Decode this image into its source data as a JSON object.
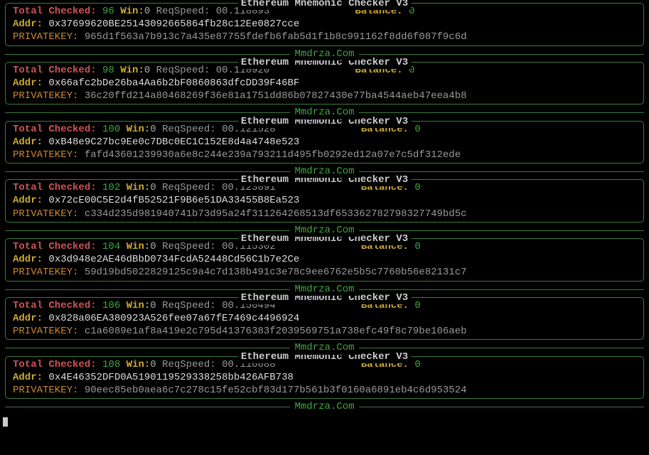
{
  "title": "Ethereum Mnemonic Checker V3",
  "footer": "Mmdrza.Com",
  "labels": {
    "totalChecked": "Total Checked:",
    "win": "Win:",
    "reqSpeed": "ReqSpeed:",
    "balance": "Balance:",
    "addr": "Addr:",
    "privateKey": "PRIVATEKEY:"
  },
  "blocks": [
    {
      "total": "96",
      "win": "0",
      "speed": "00.118893",
      "balance": "0",
      "addr": "0x37699620BE25143092665864fb28c12Ee0827cce",
      "pk": "965d1f563a7b913c7a435e87755fdefb6fab5d1f1b8c991162f8dd6f087f9c6d"
    },
    {
      "total": "98",
      "win": "0",
      "speed": "00.118920",
      "balance": "0",
      "addr": "0x66afc2bDe26ba4Aa6b2bF0860863dfcDD39F46BF",
      "pk": "36c20ffd214a80468269f36e81a1751dd86b07827430e77ba4544aeb47eea4b8"
    },
    {
      "total": "100",
      "win": "0",
      "speed": "00.121528",
      "balance": "0",
      "addr": "0xB48e9C27bc9Ee0c7DBc0EC1C152E8d4a4748e523",
      "pk": "fafd43601239930a6e8c244e239a793211d495fb0292ed12a07e7c5df312ede"
    },
    {
      "total": "102",
      "win": "0",
      "speed": "00.123091",
      "balance": "0",
      "addr": "0x72cE00C5E2d4fB52521F9B6e51DA33455B8Ea523",
      "pk": "c334d235d981940741b73d95a24f311264268513df653362782798327749bd5c"
    },
    {
      "total": "104",
      "win": "0",
      "speed": "00.115302",
      "balance": "0",
      "addr": "0x3d948e2AE46dBbD0734FcdA52448Cd56C1b7e2Ce",
      "pk": "59d19bd5022829125c9a4c7d138b491c3e78c9ee6762e5b5c7760b56e82131c7"
    },
    {
      "total": "106",
      "win": "0",
      "speed": "00.150494",
      "balance": "0",
      "addr": "0x828a06EA380923A526fee07a67fE7469c4496924",
      "pk": "c1a6089e1af8a419e2c795d41376383f2039569751a738efc49f8c79be106aeb"
    },
    {
      "total": "108",
      "win": "0",
      "speed": "00.116688",
      "balance": "0",
      "addr": "0x4E46352DFD0A5190119529338258bb426AFB738",
      "pk": "90eec85eb0aea6c7c278c15fe52cbf83d177b561b3f0160a6891eb4c6d953524"
    }
  ]
}
